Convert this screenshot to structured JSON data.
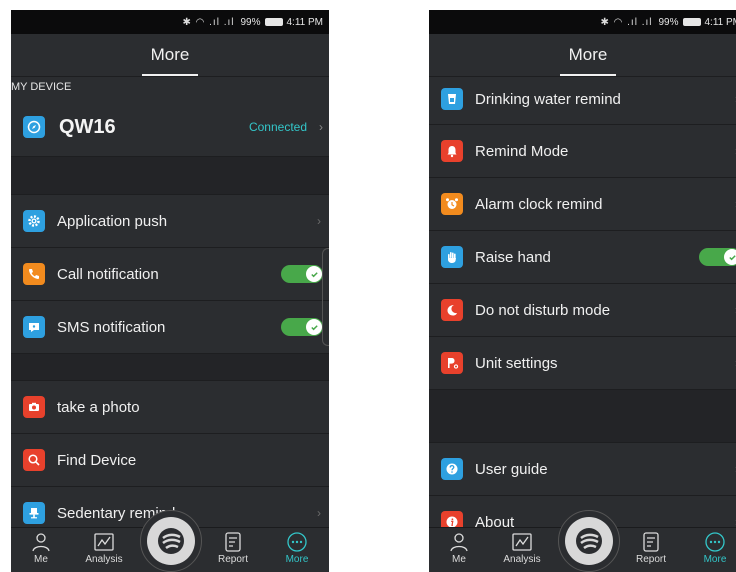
{
  "status_bar": {
    "battery": "99%",
    "time": "4:11 PM"
  },
  "left": {
    "title": "More",
    "section_label": "MY DEVICE",
    "device": {
      "name": "QW16",
      "status": "Connected"
    },
    "items": [
      {
        "label": "Application push",
        "icon": "gear-icon",
        "color": "#2ea0e0",
        "control": "chevron"
      },
      {
        "label": "Call notification",
        "icon": "phone-icon",
        "color": "#f28b1e",
        "control": "toggle"
      },
      {
        "label": "SMS notification",
        "icon": "message-icon",
        "color": "#2ea0e0",
        "control": "toggle"
      },
      {
        "label": "take a photo",
        "icon": "camera-icon",
        "color": "#e8412c",
        "control": "none"
      },
      {
        "label": "Find Device",
        "icon": "search-icon",
        "color": "#e8412c",
        "control": "none"
      },
      {
        "label": "Sedentary remind",
        "icon": "chair-icon",
        "color": "#2ea0e0",
        "control": "chevron"
      }
    ]
  },
  "right": {
    "title": "More",
    "items": [
      {
        "label": "Drinking water remind",
        "icon": "cup-icon",
        "color": "#2ea0e0",
        "control": "chevron"
      },
      {
        "label": "Remind Mode",
        "icon": "bell-icon",
        "color": "#e8412c",
        "control": "chevron"
      },
      {
        "label": "Alarm clock remind",
        "icon": "alarm-icon",
        "color": "#f28b1e",
        "control": "chevron"
      },
      {
        "label": "Raise hand",
        "icon": "hand-icon",
        "color": "#2ea0e0",
        "control": "toggle"
      },
      {
        "label": "Do not disturb mode",
        "icon": "moon-icon",
        "color": "#e8412c",
        "control": "chevron"
      },
      {
        "label": "Unit settings",
        "icon": "unit-icon",
        "color": "#e8412c",
        "control": "chevron"
      },
      {
        "label": "User guide",
        "icon": "question-icon",
        "color": "#2ea0e0",
        "control": "chevron"
      },
      {
        "label": "About",
        "icon": "info-icon",
        "color": "#e8412c",
        "control": "chevron"
      }
    ]
  },
  "tabs": [
    {
      "label": "Me",
      "icon": "person-icon",
      "active": false
    },
    {
      "label": "Analysis",
      "icon": "chart-icon",
      "active": false
    },
    {
      "label": "Report",
      "icon": "report-icon",
      "active": false
    },
    {
      "label": "More",
      "icon": "more-icon",
      "active": true
    }
  ],
  "colors": {
    "accent": "#33c6c9",
    "toggle_on": "#48a84a",
    "background": "#2b2d30"
  }
}
